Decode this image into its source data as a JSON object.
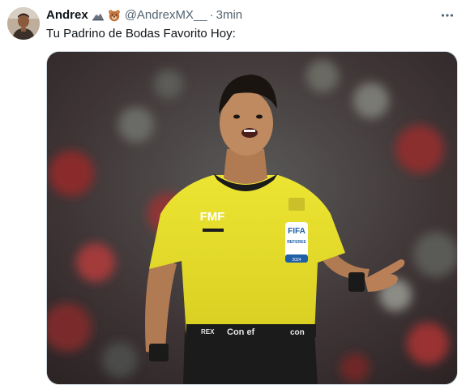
{
  "author": {
    "display_name": "Andrex",
    "handle": "@AndrexMX__",
    "timestamp": "3min",
    "badges": [
      "mountain-icon",
      "bear-face-icon"
    ]
  },
  "tweet": {
    "text": "Tu Padrino de Bodas Favorito Hoy:"
  },
  "media": {
    "jersey_text": {
      "fmf": "FMF",
      "fifa": "FIFA",
      "referee": "REFEREE",
      "year": "2024",
      "sponsor": "Con ef",
      "sponsor_short": "con",
      "waist": "REX"
    }
  },
  "actions": {
    "more_icon": "more-horizontal-icon"
  },
  "colors": {
    "text_primary": "#0f1419",
    "text_secondary": "#536471",
    "jersey_yellow": "#e6dc2c",
    "border": "#cfd9de"
  }
}
